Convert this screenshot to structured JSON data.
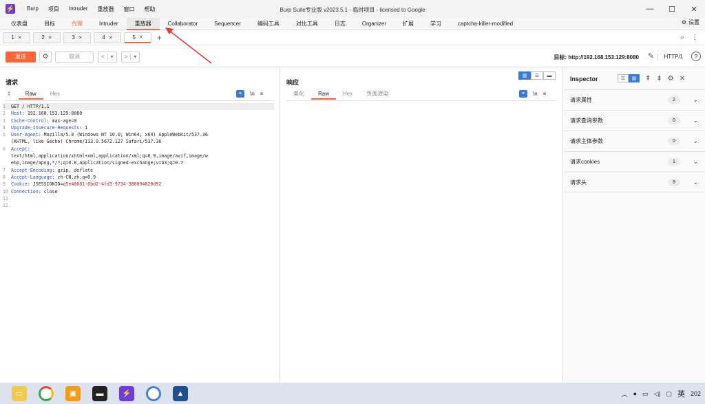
{
  "window": {
    "title": "Burp Suite专业版  v2023.5.1  -  临时项目  -  licensed to Google",
    "menu": [
      "Burp",
      "项目",
      "Intruder",
      "重放器",
      "窗口",
      "帮助"
    ]
  },
  "main_tabs": [
    {
      "label": "仪表盘"
    },
    {
      "label": "目标"
    },
    {
      "label": "代理"
    },
    {
      "label": "Intruder"
    },
    {
      "label": "重放器"
    },
    {
      "label": "Collaborator"
    },
    {
      "label": "Sequencer"
    },
    {
      "label": "编码工具"
    },
    {
      "label": "对比工具"
    },
    {
      "label": "日志"
    },
    {
      "label": "Organizer"
    },
    {
      "label": "扩展"
    },
    {
      "label": "学习"
    },
    {
      "label": "captcha-killer-modified"
    }
  ],
  "settings_label": "设置",
  "repeater_tabs": [
    "1",
    "2",
    "3",
    "4",
    "5"
  ],
  "toolbar": {
    "send": "发送",
    "cancel": "取消",
    "target": "目标: http://192.168.153.129:8080",
    "http_version": "HTTP/1"
  },
  "request": {
    "title": "请求",
    "tabs": [
      "Raw",
      "Hex"
    ],
    "newline_label": "\\n",
    "lines": [
      {
        "n": "1",
        "key": "",
        "val": "GET / HTTP/1.1",
        "cur": true
      },
      {
        "n": "2",
        "key": "Host",
        "val": ": 192.168.153.129:8080"
      },
      {
        "n": "3",
        "key": "Cache-Control",
        "val": ": max-age=0"
      },
      {
        "n": "4",
        "key": "Upgrade-Insecure-Requests",
        "val": ": 1"
      },
      {
        "n": "5",
        "key": "User-Agent",
        "val": ": Mozilla/5.0 (Windows NT 10.0; Win64; x64) AppleWebKit/537.36"
      },
      {
        "n": "",
        "key": "",
        "val": "(KHTML, like Gecko) Chrome/113.0.5672.127 Safari/537.36"
      },
      {
        "n": "6",
        "key": "Accept",
        "val": ":"
      },
      {
        "n": "",
        "key": "",
        "val": "text/html,application/xhtml+xml,application/xml;q=0.9,image/avif,image/w"
      },
      {
        "n": "",
        "key": "",
        "val": "ebp,image/apng,*/*;q=0.8,application/signed-exchange;v=b3;q=0.7"
      },
      {
        "n": "7",
        "key": "Accept-Encoding",
        "val": ": gzip, deflate"
      },
      {
        "n": "8",
        "key": "Accept-Language",
        "val": ": zh-CN,zh;q=0.9"
      },
      {
        "n": "9",
        "key": "Cookie",
        "val": ": JSESSIONID=",
        "cookie": "d5e40601-6bd2-4fd3-9734-380094020d92"
      },
      {
        "n": "10",
        "key": "Connection",
        "val": ": close"
      },
      {
        "n": "11",
        "key": "",
        "val": ""
      },
      {
        "n": "12",
        "key": "",
        "val": ""
      }
    ]
  },
  "response": {
    "title": "响应",
    "tabs": [
      "美化",
      "Raw",
      "Hex",
      "页面渲染"
    ],
    "newline_label": "\\n"
  },
  "inspector": {
    "title": "Inspector",
    "rows": [
      {
        "label": "请求属性",
        "count": "2"
      },
      {
        "label": "请求查询参数",
        "count": "0"
      },
      {
        "label": "请求主体参数",
        "count": "0"
      },
      {
        "label": "请求cookies",
        "count": "1"
      },
      {
        "label": "请求头",
        "count": "9"
      }
    ]
  },
  "taskbar": {
    "ime": "英",
    "clock": "202"
  },
  "colors": {
    "accent": "#ff6633",
    "blue": "#3a7bd5",
    "header_key": "#2f4bb3",
    "cookie_value": "#b22222",
    "annotation_arrow": "#e53935"
  }
}
